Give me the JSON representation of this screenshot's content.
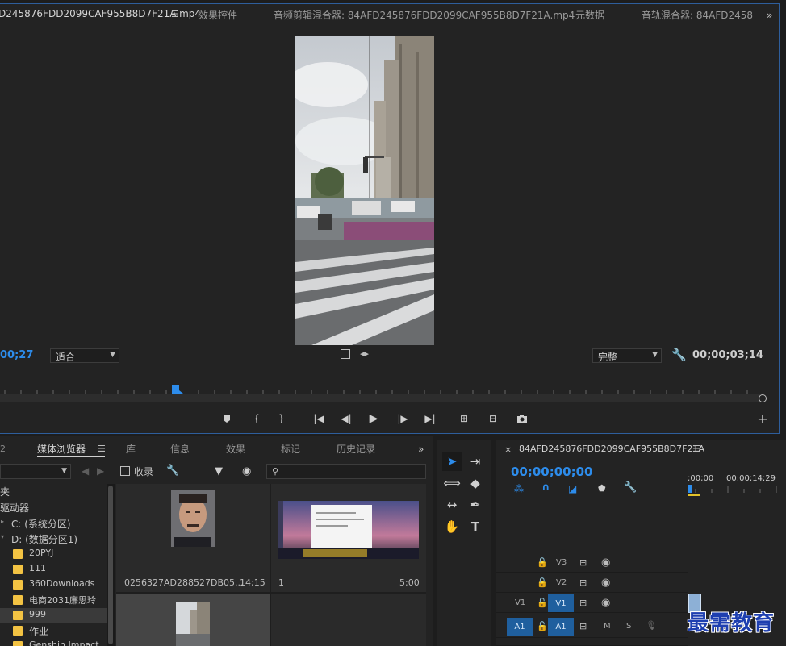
{
  "program_monitor": {
    "tabs": [
      "D245876FDD2099CAF955B8D7F21A.mp4",
      "效果控件",
      "音频剪辑混合器: 84AFD245876FDD2099CAF955B8D7F21A.mp4",
      "元数据",
      "音轨混合器: 84AFD2458"
    ],
    "overflow_label": "»",
    "current_time": "00;27",
    "fit_select": "适合",
    "quality_select": "完整",
    "duration": "00;00;03;14"
  },
  "project_panel": {
    "tabs": [
      "媒体浏览器",
      "库",
      "信息",
      "效果",
      "标记",
      "历史记录"
    ],
    "collect_label": "收录",
    "tree": [
      {
        "label": "夹"
      },
      {
        "label": "驱动器"
      },
      {
        "label": "C: (系统分区)"
      },
      {
        "label": "D: (数据分区1)"
      },
      {
        "label": "20PYJ"
      },
      {
        "label": "111"
      },
      {
        "label": "360Downloads"
      },
      {
        "label": "电商2031廉思玲"
      },
      {
        "label": "999"
      },
      {
        "label": "作业"
      },
      {
        "label": "Genshin Impact"
      }
    ],
    "items": [
      {
        "name": "0256327AD288527DB05...",
        "duration": "14;15"
      },
      {
        "name": "1",
        "duration": "5:00"
      }
    ]
  },
  "timeline": {
    "sequence_name": "84AFD245876FDD2099CAF955B8D7F21A",
    "timecode": "00;00;00;00",
    "ruler_start": ";00;00",
    "ruler_mark": "00;00;14;29",
    "tracks": [
      {
        "left": "",
        "name": "V3",
        "type": "video"
      },
      {
        "left": "",
        "name": "V2",
        "type": "video"
      },
      {
        "left": "V1",
        "name": "V1",
        "type": "video"
      },
      {
        "left": "A1",
        "name": "A1",
        "type": "audio"
      }
    ],
    "mute_label": "M",
    "solo_label": "S"
  },
  "watermark": "最需教育",
  "colors": {
    "accent": "#2d8ceb",
    "folder": "#f3c343",
    "track_target": "#1f5f9e"
  }
}
